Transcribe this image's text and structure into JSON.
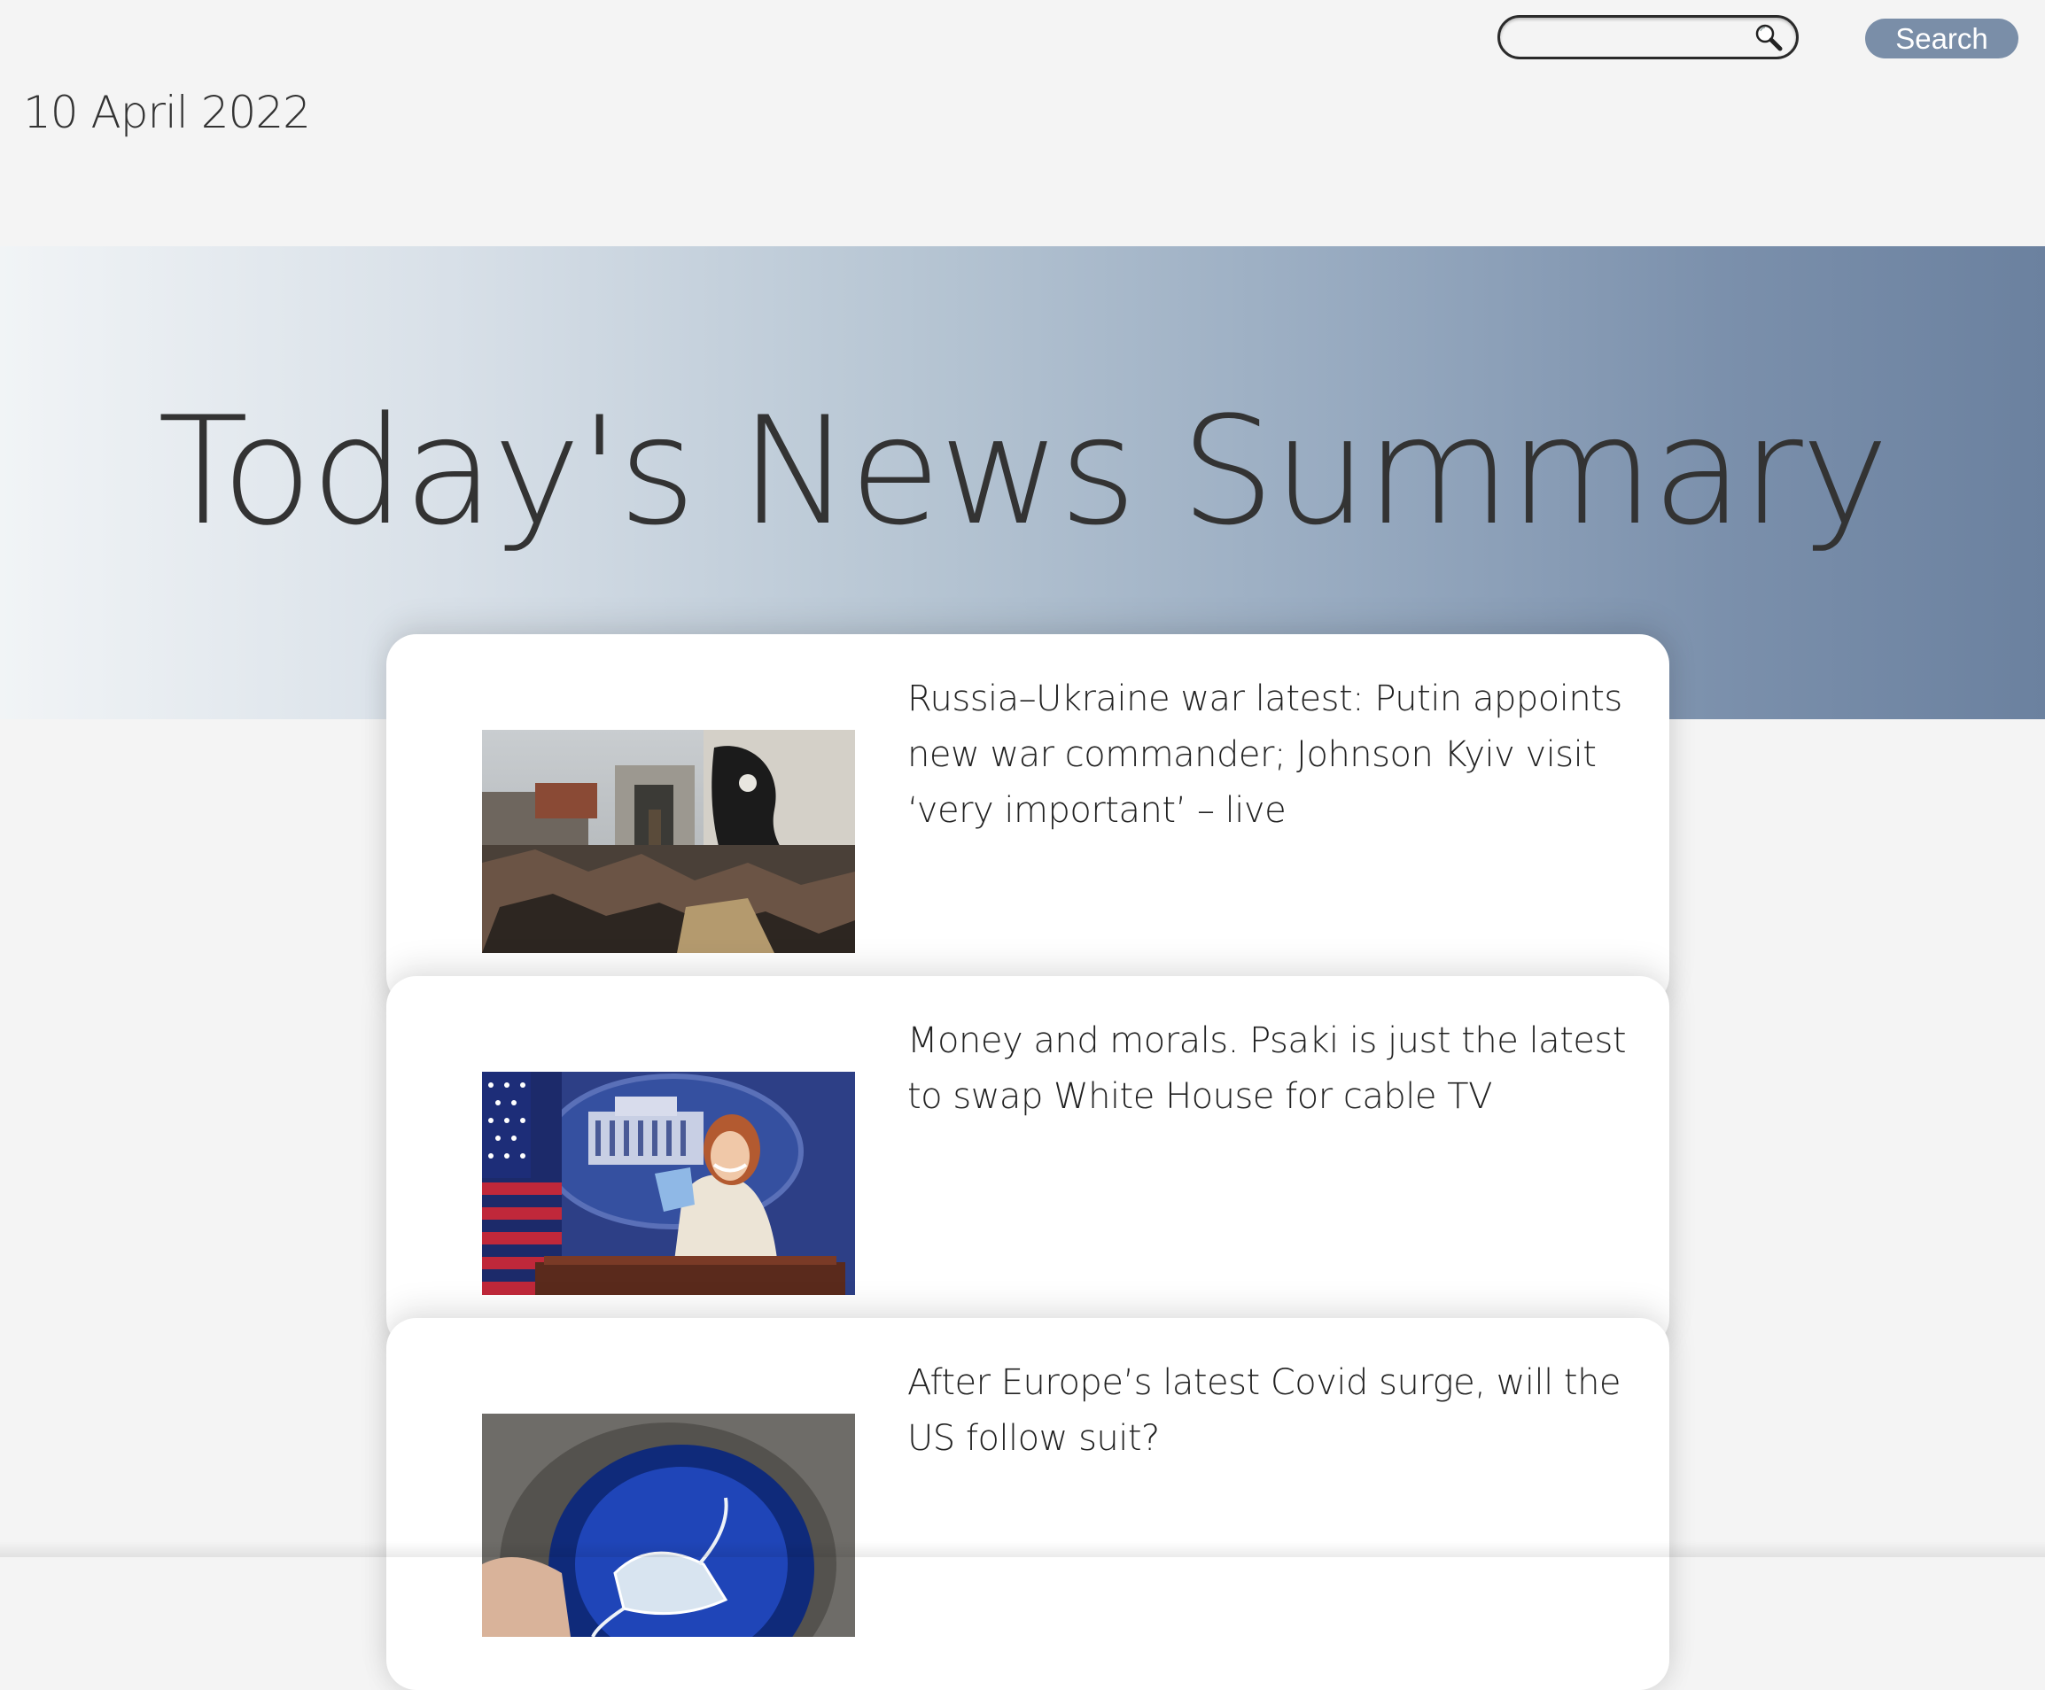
{
  "search": {
    "placeholder": "",
    "value": "",
    "button_label": "Search"
  },
  "date": "10 April 2022",
  "hero": {
    "title": "Today's News Summary"
  },
  "articles": [
    {
      "title": "Russia–Ukraine war latest: Putin appoints new war commander; Johnson Kyiv visit ‘very important’ – live",
      "image": "destroyed-buildings-photo"
    },
    {
      "title": "Money and morals. Psaki is just the latest to swap White House for cable TV",
      "image": "white-house-briefing-photo"
    },
    {
      "title": "After Europe’s latest Covid surge, will the US follow suit?",
      "image": "face-mask-in-bin-photo"
    }
  ],
  "colors": {
    "page_background": "#f4f4f4",
    "accent": "#7a8ea8",
    "hero_gradient_start": "#f1f4f6",
    "hero_gradient_end": "#6b819f",
    "card_background": "#ffffff",
    "text": "#333333"
  },
  "icons": {
    "search": "magnifier-icon"
  }
}
